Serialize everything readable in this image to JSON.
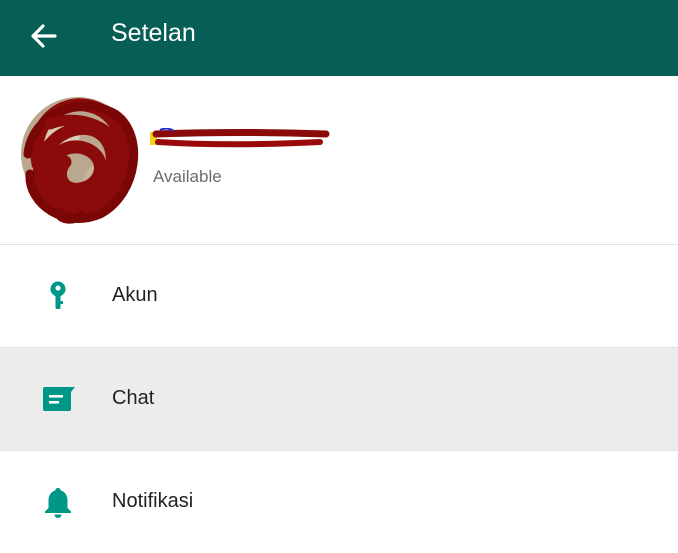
{
  "appbar": {
    "title": "Setelan",
    "back_icon": "arrow-left-icon",
    "color": "#075e54"
  },
  "profile": {
    "name": "",
    "status": "Available",
    "avatar_icon": "avatar-redacted"
  },
  "menu": {
    "items": [
      {
        "label": "Akun",
        "icon": "key-icon"
      },
      {
        "label": "Chat",
        "icon": "chat-icon"
      },
      {
        "label": "Notifikasi",
        "icon": "bell-icon"
      }
    ],
    "icon_color": "#009688",
    "active_background": "#ececec"
  }
}
